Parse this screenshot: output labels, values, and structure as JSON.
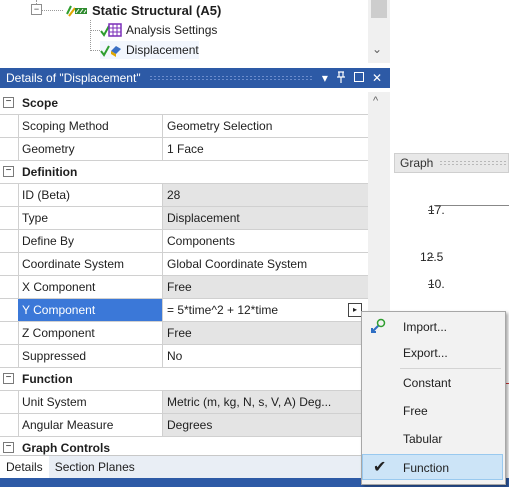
{
  "tree": {
    "node_label": "Static Structural (A5)",
    "child1_label": "Analysis Settings",
    "child2_label": "Displacement"
  },
  "details": {
    "title": "Details of \"Displacement\"",
    "controls": "▾ &#x1F4CC; □ ✕",
    "rows": [
      {
        "type": "category",
        "label": "Scope",
        "sign": "−"
      },
      {
        "name": "Scoping Method",
        "value": "Geometry Selection"
      },
      {
        "name": "Geometry",
        "value": "1 Face"
      },
      {
        "type": "category",
        "label": "Definition",
        "sign": "−"
      },
      {
        "name": "ID (Beta)",
        "value": "28",
        "readonly": true
      },
      {
        "name": "Type",
        "value": "Displacement",
        "readonly": true
      },
      {
        "name": "Define By",
        "value": "Components"
      },
      {
        "name": "Coordinate System",
        "value": "Global Coordinate System"
      },
      {
        "name": "X Component",
        "value": "Free",
        "readonly": true
      },
      {
        "name": "Y Component",
        "value": "= 5*time^2 + 12*time",
        "selected": true
      },
      {
        "name": "Z Component",
        "value": "Free",
        "readonly": true
      },
      {
        "name": "Suppressed",
        "value": "No"
      },
      {
        "type": "category",
        "label": "Function",
        "sign": "−"
      },
      {
        "name": "Unit System",
        "value": "Metric (m, kg, N, s, V, A)  Deg...",
        "readonly": true
      },
      {
        "name": "Angular Measure",
        "value": "Degrees",
        "readonly": true
      },
      {
        "type": "category",
        "label": "Graph Controls",
        "sign": "−"
      }
    ]
  },
  "tabs": [
    "Details",
    "Section Planes"
  ],
  "graph": {
    "title": "Graph",
    "ticks": [
      "17.",
      "12.5",
      "10."
    ]
  },
  "menu": {
    "items": [
      {
        "label": "Import...",
        "icon": "import-icon"
      },
      {
        "label": "Export..."
      },
      {
        "label": "Constant"
      },
      {
        "label": "Free"
      },
      {
        "label": "Tabular"
      },
      {
        "label": "Function",
        "checked": true
      }
    ]
  },
  "colors": {
    "accent": "#2d5aa6",
    "selection": "#3b78d8",
    "menu_highlight": "#cce4f7"
  }
}
